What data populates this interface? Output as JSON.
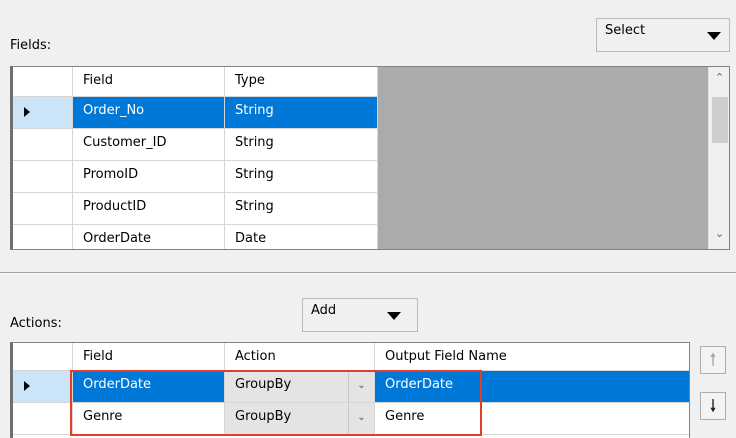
{
  "fields_section": {
    "label": "Fields:",
    "select_button": "Select",
    "columns": [
      "Field",
      "Type"
    ],
    "rows": [
      {
        "field": "Order_No",
        "type": "String",
        "selected": true
      },
      {
        "field": "Customer_ID",
        "type": "String"
      },
      {
        "field": "PromoID",
        "type": "String"
      },
      {
        "field": "ProductID",
        "type": "String"
      },
      {
        "field": "OrderDate",
        "type": "Date"
      }
    ]
  },
  "actions_section": {
    "label": "Actions:",
    "add_button": "Add",
    "columns": [
      "Field",
      "Action",
      "Output Field Name"
    ],
    "rows": [
      {
        "field": "OrderDate",
        "action": "GroupBy",
        "output": "OrderDate",
        "selected": true
      },
      {
        "field": "Genre",
        "action": "GroupBy",
        "output": "Genre"
      }
    ],
    "move_up_icon": "arrow-up-icon",
    "move_down_icon": "arrow-down-icon"
  },
  "colors": {
    "selection": "#0078d7",
    "highlight_box": "#e23f2a",
    "row_indicator": "#cce4f7",
    "empty_grid_area": "#ababab"
  }
}
